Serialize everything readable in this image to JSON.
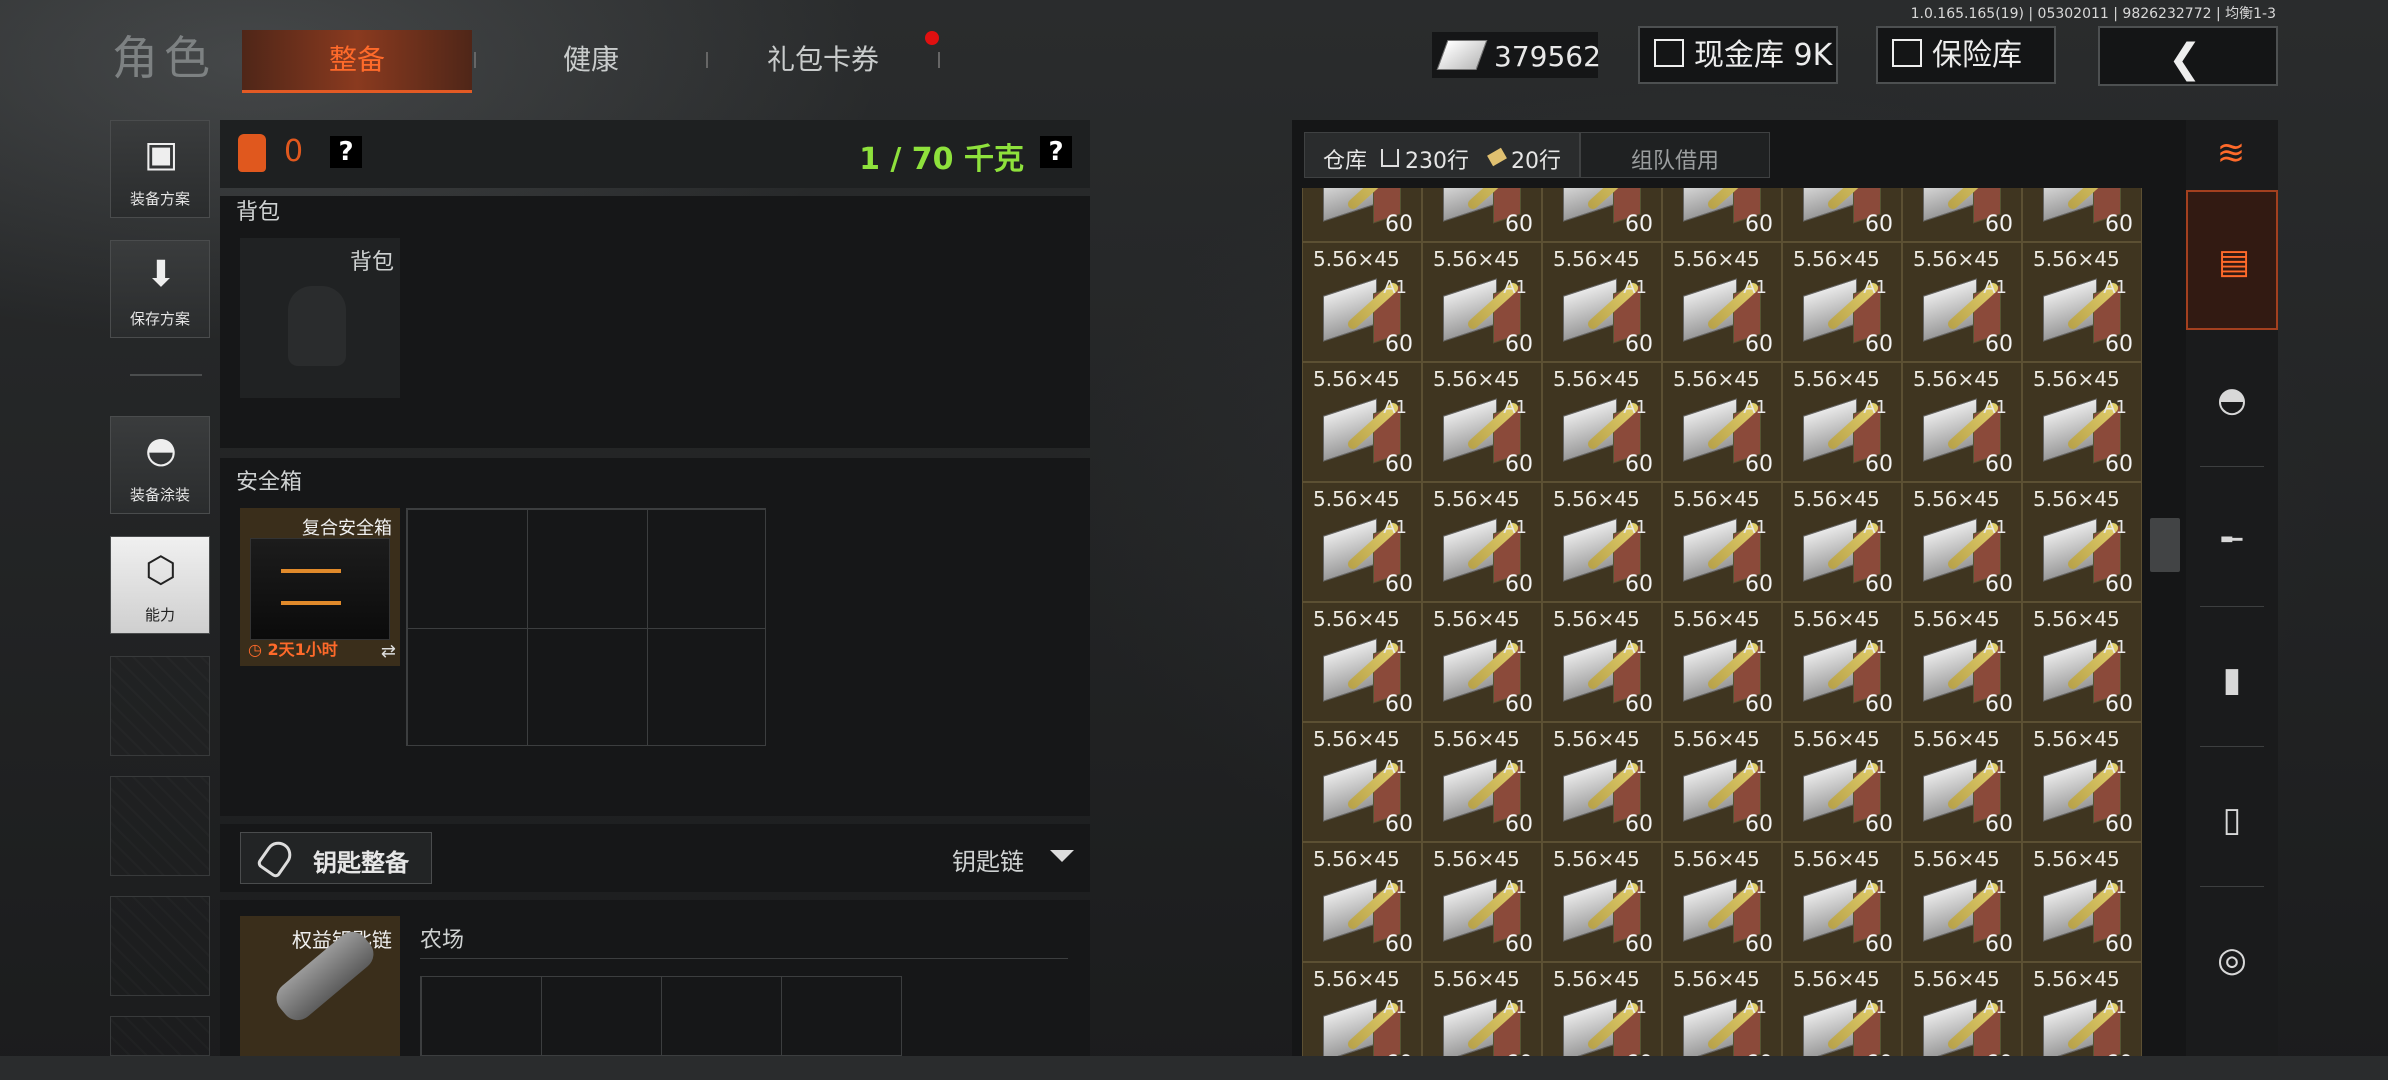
{
  "version": "1.0.165.165(19) | 05302011 | 9826232772 | 均衡1-3",
  "header": {
    "title": "角色",
    "tabs": [
      {
        "label": "整备",
        "active": true
      },
      {
        "label": "健康",
        "active": false
      },
      {
        "label": "礼包卡券",
        "active": false,
        "notification": true
      }
    ],
    "money": "379562",
    "cash_vault": "现金库 9K",
    "insurance": "保险库"
  },
  "sidebar": {
    "items": [
      {
        "label": "装备方案",
        "icon": "vest-icon"
      },
      {
        "label": "保存方案",
        "icon": "download-icon"
      },
      {
        "label": "装备涂装",
        "icon": "helmet-icon"
      },
      {
        "label": "能力",
        "icon": "bolt-icon"
      }
    ]
  },
  "loadout": {
    "armor_count": "0",
    "weight": "1 / 70 千克",
    "help": "?",
    "backpack_section": "背包",
    "backpack_slot": "背包",
    "safebox_section": "安全箱",
    "safebox_name": "复合安全箱",
    "safebox_timer": "2天1小时",
    "key_button": "钥匙整备",
    "keychain_label": "钥匙链",
    "keychain_slot": "权益钥匙链",
    "farm_label": "农场"
  },
  "warehouse": {
    "tab_storage": "仓库",
    "rows_home": "230行",
    "rows_tag": "20行",
    "tab_team": "组队借用",
    "item_caliber": "5.56×45",
    "item_badge": "A1",
    "item_qty": "60",
    "categories": [
      "stack-icon",
      "helmet-icon",
      "rifle-icon",
      "magazine-icon",
      "bullet-icon",
      "scope-icon"
    ]
  },
  "colors": {
    "accent": "#e0581e",
    "weight_green": "#8ee13c",
    "item_bg": "#3f3520"
  }
}
